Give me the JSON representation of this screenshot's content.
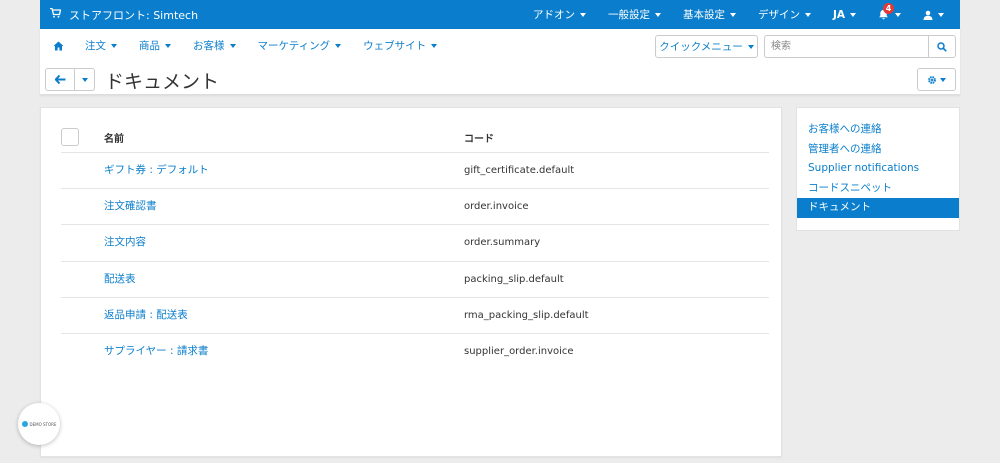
{
  "topbar": {
    "storefront_label": "ストアフロント: Simtech",
    "menus": [
      {
        "label": "アドオン"
      },
      {
        "label": "一般設定"
      },
      {
        "label": "基本設定"
      },
      {
        "label": "デザイン"
      },
      {
        "label": "JA"
      }
    ],
    "notification_count": "4"
  },
  "nav": {
    "items": [
      {
        "label": "注文"
      },
      {
        "label": "商品"
      },
      {
        "label": "お客様"
      },
      {
        "label": "マーケティング"
      },
      {
        "label": "ウェブサイト"
      }
    ],
    "quick_menu_label": "クイックメニュー",
    "search_placeholder": "検索"
  },
  "page": {
    "title": "ドキュメント"
  },
  "table": {
    "headers": {
      "name": "名前",
      "code": "コード"
    },
    "rows": [
      {
        "name": "ギフト券 : デフォルト",
        "code": "gift_certificate.default"
      },
      {
        "name": "注文確認書",
        "code": "order.invoice"
      },
      {
        "name": "注文内容",
        "code": "order.summary"
      },
      {
        "name": "配送表",
        "code": "packing_slip.default"
      },
      {
        "name": "返品申請 : 配送表",
        "code": "rma_packing_slip.default"
      },
      {
        "name": "サプライヤー : 請求書",
        "code": "supplier_order.invoice"
      }
    ]
  },
  "sidebar": {
    "items": [
      {
        "label": "お客様への連絡"
      },
      {
        "label": "管理者への連絡"
      },
      {
        "label": "Supplier notifications"
      },
      {
        "label": "コードスニペット"
      },
      {
        "label": "ドキュメント"
      }
    ],
    "active_index": 4
  },
  "demo_badge": {
    "label": "DEMO STORE"
  },
  "colors": {
    "primary": "#0a7ecc",
    "background": "#ececec",
    "badge": "#e53935"
  },
  "icons": [
    "cart-icon",
    "bell-icon",
    "user-icon",
    "home-icon",
    "search-icon",
    "arrow-left-icon",
    "gear-icon"
  ]
}
